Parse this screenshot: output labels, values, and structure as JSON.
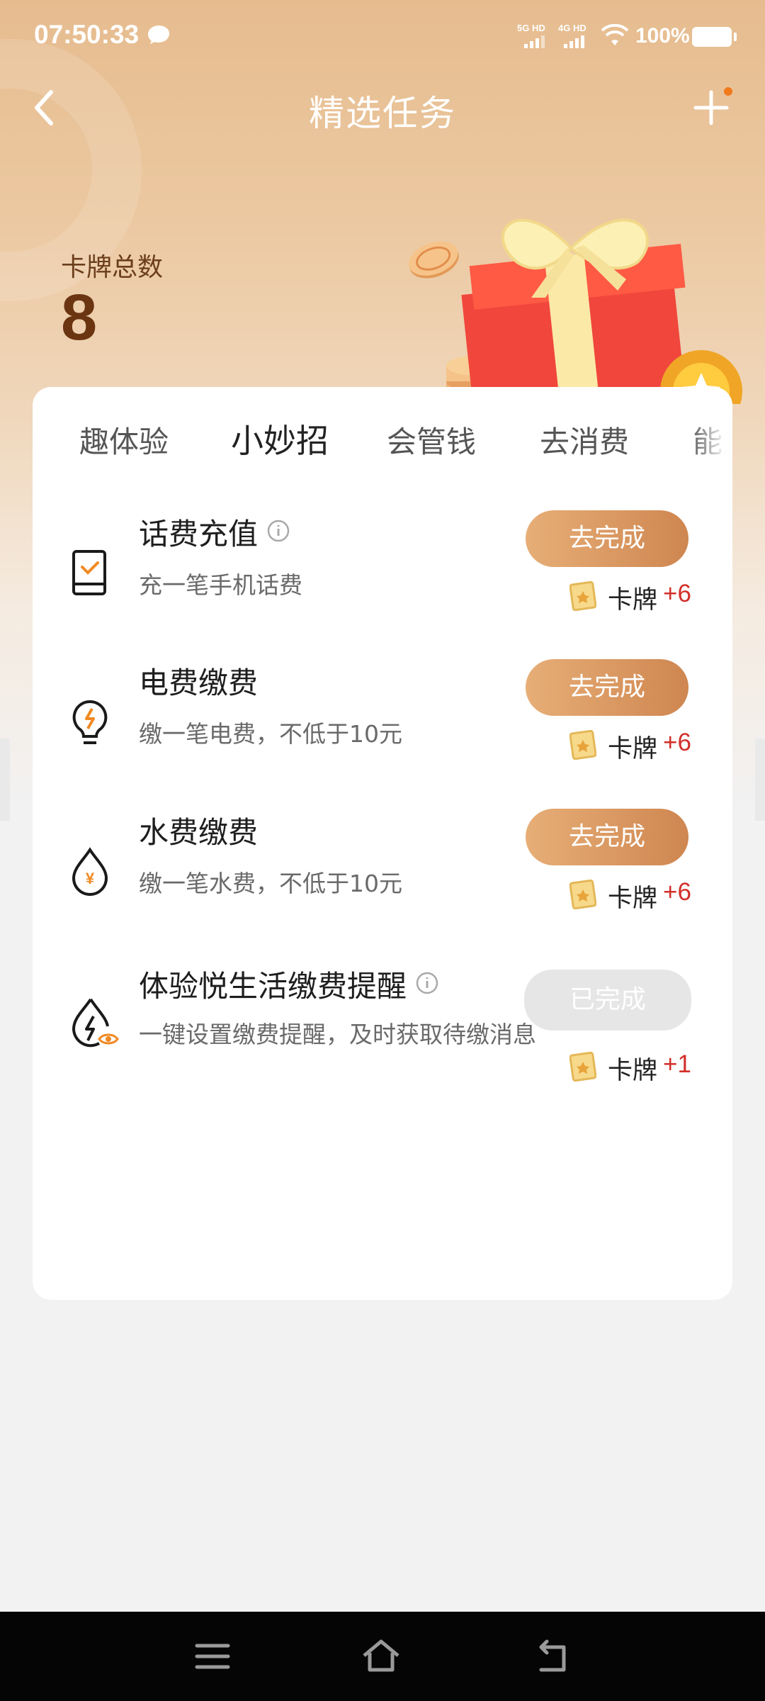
{
  "status_bar": {
    "time": "07:50:33",
    "net1": "5G HD",
    "net2": "4G HD",
    "battery": "100%"
  },
  "header": {
    "title": "精选任务"
  },
  "summary": {
    "label": "卡牌总数",
    "value": "8"
  },
  "tabs": [
    {
      "label": "趣体验"
    },
    {
      "label": "小妙招",
      "active": true
    },
    {
      "label": "会管钱"
    },
    {
      "label": "去消费"
    },
    {
      "label": "能力"
    }
  ],
  "tasks": [
    {
      "icon": "phone-bill-icon",
      "title": "话费充值",
      "has_info": true,
      "desc": "充一笔手机话费",
      "button": "去完成",
      "reward_label": "卡牌",
      "reward_value": "+6",
      "done": false
    },
    {
      "icon": "bulb-icon",
      "title": "电费缴费",
      "has_info": false,
      "desc": "缴一笔电费，不低于10元",
      "button": "去完成",
      "reward_label": "卡牌",
      "reward_value": "+6",
      "done": false
    },
    {
      "icon": "water-drop-icon",
      "title": "水费缴费",
      "has_info": false,
      "desc": "缴一笔水费，不低于10元",
      "button": "去完成",
      "reward_label": "卡牌",
      "reward_value": "+6",
      "done": false
    },
    {
      "icon": "reminder-icon",
      "title": "体验悦生活缴费提醒",
      "has_info": true,
      "desc": "一键设置缴费提醒，及时获取待缴消息",
      "button": "已完成",
      "reward_label": "卡牌",
      "reward_value": "+1",
      "done": true
    }
  ],
  "colors": {
    "accent": "#d58c56",
    "reward": "#d22f2a",
    "header_gradient_top": "#e6bc8f"
  }
}
